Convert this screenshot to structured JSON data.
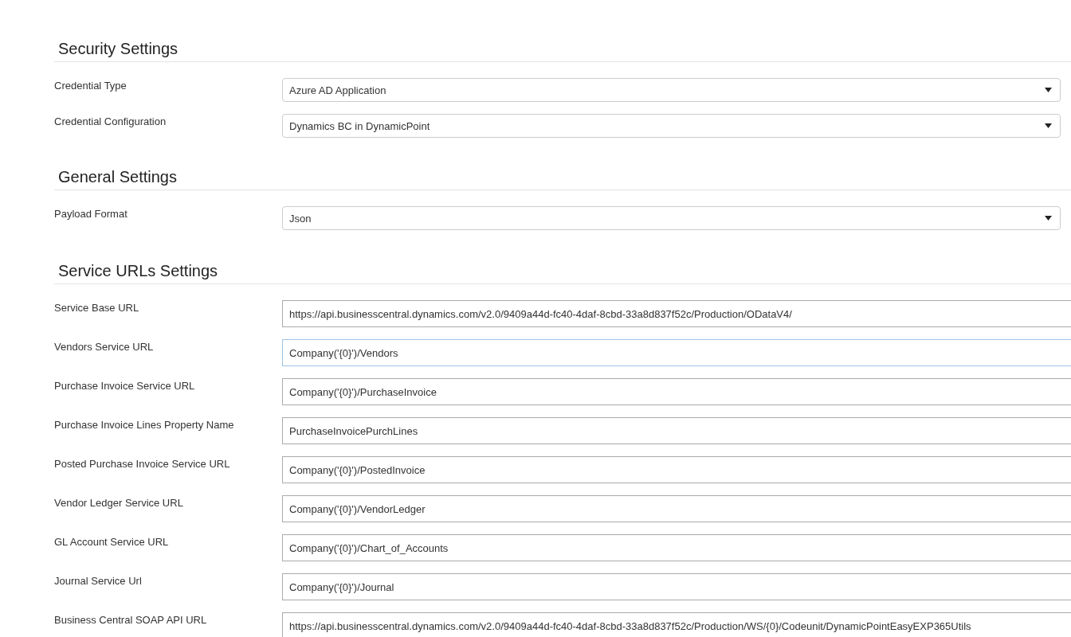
{
  "sections": [
    {
      "title": "Security Settings",
      "fields": [
        {
          "label": "Credential Type",
          "kind": "select",
          "value": "Azure AD Application",
          "focused": false
        },
        {
          "label": "Credential Configuration",
          "kind": "select",
          "value": "Dynamics BC in DynamicPoint",
          "focused": false
        }
      ]
    },
    {
      "title": "General Settings",
      "fields": [
        {
          "label": "Payload Format",
          "kind": "select",
          "value": "Json",
          "focused": false
        }
      ]
    },
    {
      "title": "Service URLs Settings",
      "fields": [
        {
          "label": "Service Base URL",
          "kind": "text",
          "value": "https://api.businesscentral.dynamics.com/v2.0/9409a44d-fc40-4daf-8cbd-33a8d837f52c/Production/ODataV4/",
          "focused": false
        },
        {
          "label": "Vendors Service URL",
          "kind": "text",
          "value": "Company('{0}')/Vendors",
          "focused": true
        },
        {
          "label": "Purchase Invoice Service URL",
          "kind": "text",
          "value": "Company('{0}')/PurchaseInvoice",
          "focused": false
        },
        {
          "label": "Purchase Invoice Lines Property Name",
          "kind": "text",
          "value": "PurchaseInvoicePurchLines",
          "focused": false
        },
        {
          "label": "Posted Purchase Invoice Service URL",
          "kind": "text",
          "value": "Company('{0}')/PostedInvoice",
          "focused": false
        },
        {
          "label": "Vendor Ledger Service URL",
          "kind": "text",
          "value": "Company('{0}')/VendorLedger",
          "focused": false
        },
        {
          "label": "GL Account Service URL",
          "kind": "text",
          "value": "Company('{0}')/Chart_of_Accounts",
          "focused": false
        },
        {
          "label": "Journal Service Url",
          "kind": "text",
          "value": "Company('{0}')/Journal",
          "focused": false
        },
        {
          "label": "Business Central SOAP API URL",
          "kind": "text",
          "value": "https://api.businesscentral.dynamics.com/v2.0/9409a44d-fc40-4daf-8cbd-33a8d837f52c/Production/WS/{0}/Codeunit/DynamicPointEasyEXP365Utils",
          "focused": false
        }
      ]
    }
  ]
}
